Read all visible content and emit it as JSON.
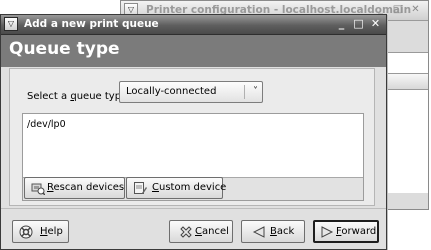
{
  "background_window": {
    "title": "Printer configuration - localhost.localdomain",
    "menu_icon": "window-menu-icon",
    "controls": [
      "_",
      "□",
      "✕"
    ]
  },
  "dialog": {
    "title": "Add a new print queue",
    "menu_icon": "window-menu-icon",
    "controls": [
      "_",
      "□",
      "✕"
    ],
    "header": "Queue type",
    "queue_type": {
      "label_prefix": "Select a ",
      "label_underlined": "q",
      "label_suffix": "ueue type:",
      "selected": "Locally-connected",
      "arrow": "˅"
    },
    "devices": [
      "/dev/lp0"
    ],
    "device_buttons": {
      "rescan": "Rescan devices",
      "custom": "Custom device"
    },
    "buttons": {
      "help": "Help",
      "cancel": "Cancel",
      "back": "Back",
      "forward": "Forward"
    }
  }
}
